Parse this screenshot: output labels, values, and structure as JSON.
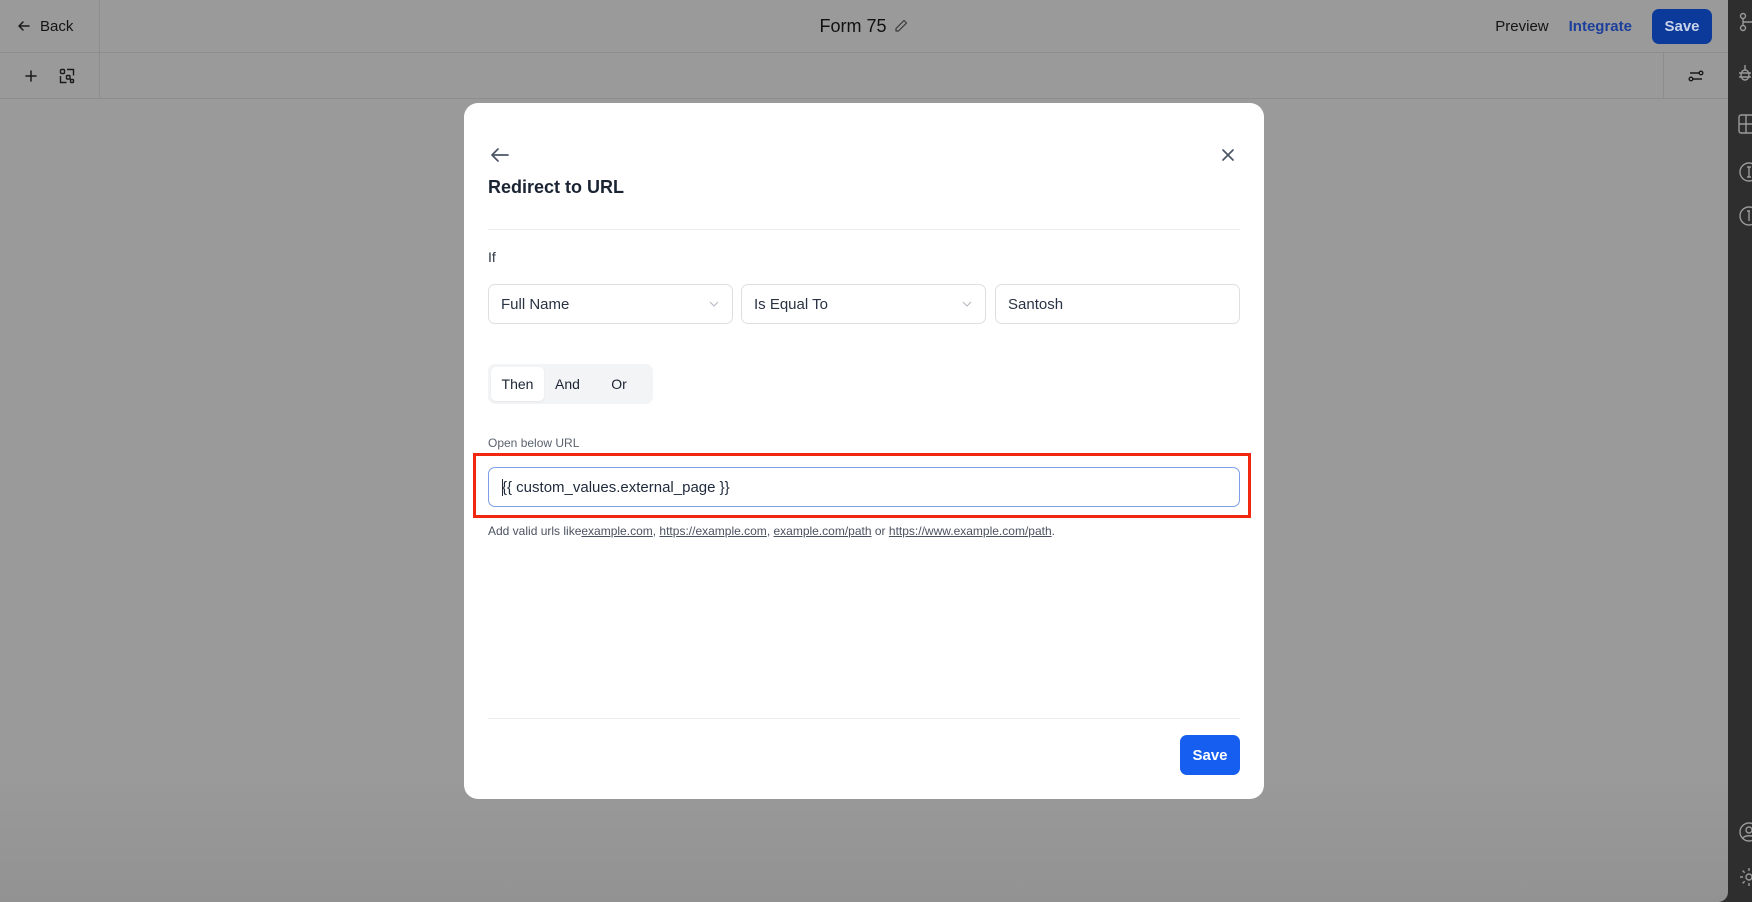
{
  "header": {
    "back_label": "Back",
    "title": "Form 75",
    "preview_label": "Preview",
    "integrate_label": "Integrate",
    "save_label": "Save"
  },
  "toolbar": {
    "add_icon": "plus-icon",
    "layout_icon": "layout-elements-icon",
    "settings_icon": "sliders-icon"
  },
  "side_strip": {
    "icons": [
      "branch-icon",
      "bug-icon",
      "layout-icon",
      "info-icon",
      "info-icon",
      "user-circle-icon",
      "gear-icon"
    ]
  },
  "modal": {
    "title": "Redirect to URL",
    "if_label": "If",
    "condition": {
      "field": "Full Name",
      "operator": "Is Equal To",
      "value": "Santosh"
    },
    "logic_options": [
      {
        "label": "Then",
        "selected": true
      },
      {
        "label": "And",
        "selected": false
      },
      {
        "label": "Or",
        "selected": false
      }
    ],
    "url_label": "Open below URL",
    "url_value": "{{ custom_values.external_page }}",
    "hint": {
      "prefix": "Add valid urls like",
      "examples": [
        "example.com",
        "https://example.com",
        "example.com/path",
        "https://www.example.com/path"
      ],
      "sep1": ", ",
      "sep2": ", ",
      "sep3": " or ",
      "suffix": "."
    },
    "save_label": "Save"
  },
  "colors": {
    "primary": "#155eef",
    "highlight": "#f0280f",
    "integrate": "#1d3f9c"
  }
}
